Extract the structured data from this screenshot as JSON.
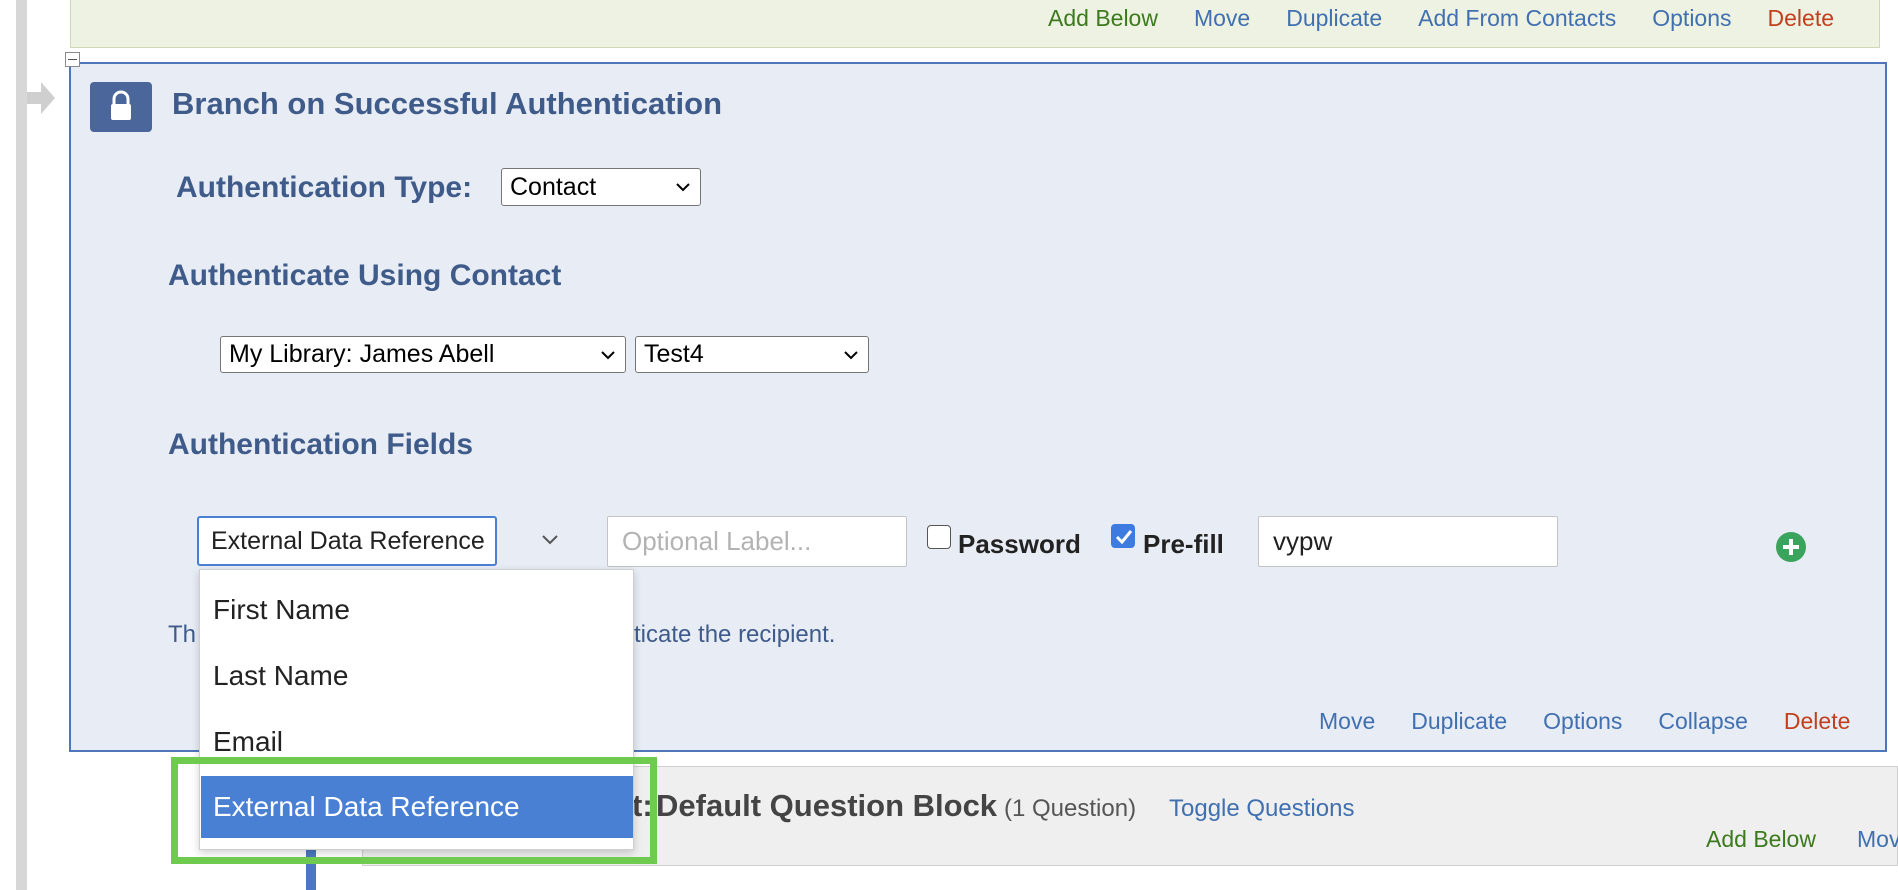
{
  "top_toolbar": {
    "add_below": "Add Below",
    "move": "Move",
    "duplicate": "Duplicate",
    "add_from_contacts": "Add From Contacts",
    "options": "Options",
    "delete": "Delete"
  },
  "branch": {
    "title": "Branch on Successful Authentication",
    "auth_type_label": "Authentication Type:",
    "auth_type_value": "Contact",
    "auth_using_heading": "Authenticate Using Contact",
    "library_value": "My Library: James Abell",
    "list_value": "Test4",
    "fields_heading": "Authentication Fields",
    "field_select_value": "External Data Reference",
    "label_placeholder": "Optional Label...",
    "password_label": "Password",
    "password_checked": false,
    "prefill_label": "Pre-fill",
    "prefill_checked": true,
    "prefill_value": "vypw",
    "help_text_start": "Th",
    "help_text_end": "ticate the recipient.",
    "bottom_toolbar": {
      "move": "Move",
      "duplicate": "Duplicate",
      "options": "Options",
      "collapse": "Collapse",
      "delete": "Delete"
    }
  },
  "dropdown": {
    "options": [
      "First Name",
      "Last Name",
      "Email",
      "External Data Reference"
    ],
    "selected": "External Data Reference"
  },
  "default_block": {
    "title_prefix": "t:",
    "title": "Default Question Block",
    "count": "(1 Question)",
    "toggle": "Toggle Questions",
    "add_below": "Add Below",
    "move_partial": "Mov"
  },
  "colors": {
    "action_green": "#3c7a1e",
    "action_blue": "#4170b0",
    "action_red": "#c2401d",
    "heading_blue": "#3f5b8a",
    "selected_option": "#4a80d4",
    "highlight_green": "#6fcb4f"
  },
  "icons": {
    "lock": "lock-icon",
    "add": "plus-circle-icon",
    "chevron": "chevron-down-icon",
    "collapse": "minus-box-icon",
    "flow_arrow": "flow-arrow-icon"
  }
}
